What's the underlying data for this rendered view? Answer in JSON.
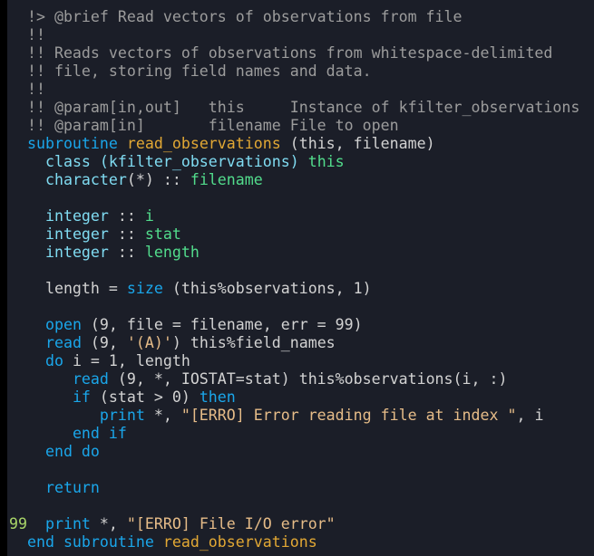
{
  "editor": {
    "language": "fortran",
    "colors": {
      "background": "#1b1e28",
      "comment": "#9c9c9c",
      "keyword": "#1aa6ea",
      "type": "#80dcf2",
      "variable": "#52dc8c",
      "function": "#e2a834",
      "string": "#e6bc88",
      "label": "#a8d468",
      "plain": "#d2d2d2"
    },
    "lines": [
      [
        {
          "t": "comment",
          "v": "  !> @brief Read vectors of observations from file"
        }
      ],
      [
        {
          "t": "comment",
          "v": "  !!"
        }
      ],
      [
        {
          "t": "comment",
          "v": "  !! Reads vectors of observations from whitespace-delimited"
        }
      ],
      [
        {
          "t": "comment",
          "v": "  !! file, storing field names and data."
        }
      ],
      [
        {
          "t": "comment",
          "v": "  !!"
        }
      ],
      [
        {
          "t": "comment",
          "v": "  !! @param[in,out]   this     Instance of kfilter_observations"
        }
      ],
      [
        {
          "t": "comment",
          "v": "  !! @param[in]       filename File to open"
        }
      ],
      [
        {
          "t": "plain",
          "v": "  "
        },
        {
          "t": "keyword",
          "v": "subroutine"
        },
        {
          "t": "plain",
          "v": " "
        },
        {
          "t": "func",
          "v": "read_observations"
        },
        {
          "t": "plain",
          "v": " (this, filename)"
        }
      ],
      [
        {
          "t": "plain",
          "v": "    "
        },
        {
          "t": "type",
          "v": "class (kfilter_observations)"
        },
        {
          "t": "plain",
          "v": " "
        },
        {
          "t": "var",
          "v": "this"
        }
      ],
      [
        {
          "t": "plain",
          "v": "    "
        },
        {
          "t": "type",
          "v": "character"
        },
        {
          "t": "plain",
          "v": "(*) :: "
        },
        {
          "t": "var",
          "v": "filename"
        }
      ],
      [],
      [
        {
          "t": "plain",
          "v": "    "
        },
        {
          "t": "type",
          "v": "integer"
        },
        {
          "t": "plain",
          "v": " :: "
        },
        {
          "t": "var",
          "v": "i"
        }
      ],
      [
        {
          "t": "plain",
          "v": "    "
        },
        {
          "t": "type",
          "v": "integer"
        },
        {
          "t": "plain",
          "v": " :: "
        },
        {
          "t": "var",
          "v": "stat"
        }
      ],
      [
        {
          "t": "plain",
          "v": "    "
        },
        {
          "t": "type",
          "v": "integer"
        },
        {
          "t": "plain",
          "v": " :: "
        },
        {
          "t": "var",
          "v": "length"
        }
      ],
      [],
      [
        {
          "t": "plain",
          "v": "    length = "
        },
        {
          "t": "keyword",
          "v": "size"
        },
        {
          "t": "plain",
          "v": " (this%observations, 1)"
        }
      ],
      [],
      [
        {
          "t": "plain",
          "v": "    "
        },
        {
          "t": "keyword",
          "v": "open"
        },
        {
          "t": "plain",
          "v": " (9, file = filename, err = 99)"
        }
      ],
      [
        {
          "t": "plain",
          "v": "    "
        },
        {
          "t": "keyword",
          "v": "read"
        },
        {
          "t": "plain",
          "v": " (9, "
        },
        {
          "t": "string",
          "v": "'(A)'"
        },
        {
          "t": "plain",
          "v": ") this%field_names"
        }
      ],
      [
        {
          "t": "plain",
          "v": "    "
        },
        {
          "t": "keyword",
          "v": "do"
        },
        {
          "t": "plain",
          "v": " i = 1, length"
        }
      ],
      [
        {
          "t": "plain",
          "v": "       "
        },
        {
          "t": "keyword",
          "v": "read"
        },
        {
          "t": "plain",
          "v": " (9, *, IOSTAT=stat) this%observations(i, :)"
        }
      ],
      [
        {
          "t": "plain",
          "v": "       "
        },
        {
          "t": "keyword",
          "v": "if"
        },
        {
          "t": "plain",
          "v": " (stat > 0) "
        },
        {
          "t": "keyword",
          "v": "then"
        }
      ],
      [
        {
          "t": "plain",
          "v": "          "
        },
        {
          "t": "keyword",
          "v": "print"
        },
        {
          "t": "plain",
          "v": " *, "
        },
        {
          "t": "string",
          "v": "\"[ERRO] Error reading file at index \""
        },
        {
          "t": "plain",
          "v": ", i"
        }
      ],
      [
        {
          "t": "plain",
          "v": "       "
        },
        {
          "t": "keyword",
          "v": "end if"
        }
      ],
      [
        {
          "t": "plain",
          "v": "    "
        },
        {
          "t": "keyword",
          "v": "end do"
        }
      ],
      [],
      [
        {
          "t": "plain",
          "v": "    "
        },
        {
          "t": "keyword",
          "v": "return"
        }
      ],
      [],
      [
        {
          "t": "label",
          "v": "99"
        },
        {
          "t": "plain",
          "v": "  "
        },
        {
          "t": "keyword",
          "v": "print"
        },
        {
          "t": "plain",
          "v": " *, "
        },
        {
          "t": "string",
          "v": "\"[ERRO] File I/O error\""
        }
      ],
      [
        {
          "t": "plain",
          "v": "  "
        },
        {
          "t": "keyword",
          "v": "end subroutine"
        },
        {
          "t": "plain",
          "v": " "
        },
        {
          "t": "func",
          "v": "read_observations"
        }
      ]
    ]
  }
}
